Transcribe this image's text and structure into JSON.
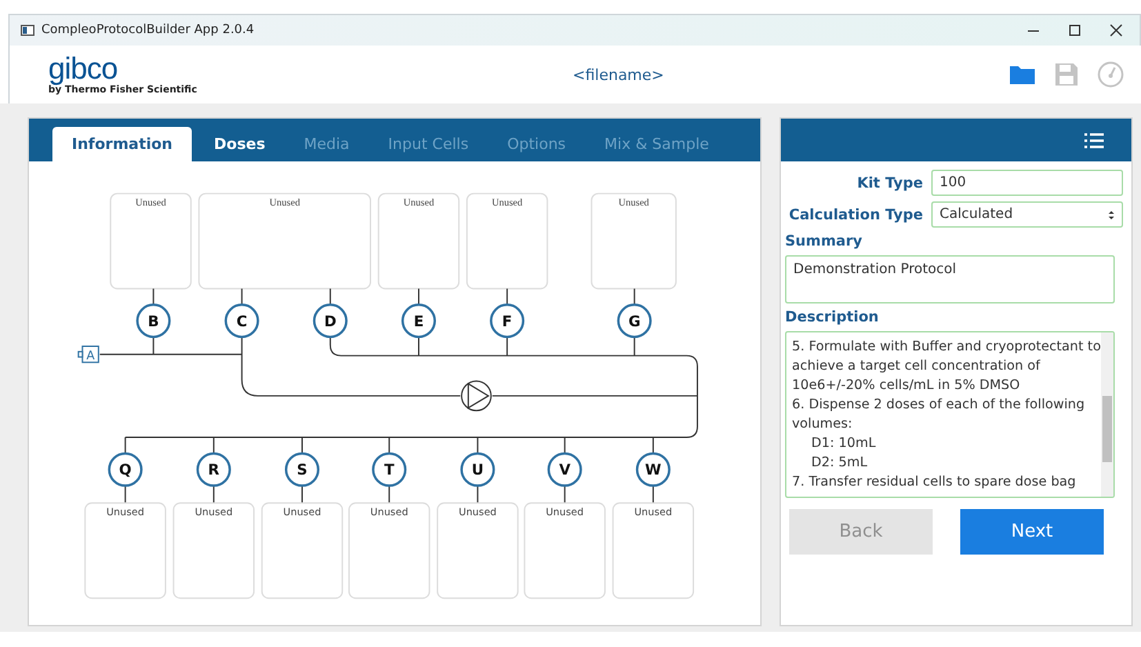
{
  "window": {
    "title": "CompleoProtocolBuilder App 2.0.4"
  },
  "header": {
    "logo": "gibco",
    "logo_sub": "by Thermo Fisher Scientific",
    "filename": "<filename>",
    "actions": [
      {
        "kind": "open",
        "disabled": false
      },
      {
        "kind": "save",
        "disabled": true
      },
      {
        "kind": "gauge",
        "disabled": true
      }
    ]
  },
  "tabs": [
    {
      "label": "Information",
      "selected": true,
      "disabled": false
    },
    {
      "label": "Doses",
      "selected": false,
      "disabled": false
    },
    {
      "label": "Media",
      "selected": false,
      "disabled": true
    },
    {
      "label": "Input Cells",
      "selected": false,
      "disabled": true
    },
    {
      "label": "Options",
      "selected": false,
      "disabled": true
    },
    {
      "label": "Mix & Sample",
      "selected": false,
      "disabled": true
    }
  ],
  "diagram": {
    "source": "A",
    "top_bags": [
      {
        "label": "Unused",
        "ports": [
          "B"
        ]
      },
      {
        "label": "Unused",
        "ports": [
          "C",
          "D"
        ]
      },
      {
        "label": "Unused",
        "ports": [
          "E"
        ]
      },
      {
        "label": "Unused",
        "ports": [
          "F"
        ]
      },
      {
        "label": "Unused",
        "ports": [
          "G"
        ]
      }
    ],
    "bottom_ports": [
      {
        "port": "Q",
        "bag": "Unused"
      },
      {
        "port": "R",
        "bag": "Unused"
      },
      {
        "port": "S",
        "bag": "Unused"
      },
      {
        "port": "T",
        "bag": "Unused"
      },
      {
        "port": "U",
        "bag": "Unused"
      },
      {
        "port": "V",
        "bag": "Unused"
      },
      {
        "port": "W",
        "bag": "Unused"
      }
    ]
  },
  "form": {
    "kit_type": {
      "label": "Kit Type",
      "value": "100"
    },
    "calculation_type": {
      "label": "Calculation Type",
      "value": "Calculated"
    },
    "summary": {
      "label": "Summary",
      "value": "Demonstration Protocol"
    },
    "description": {
      "label": "Description",
      "lines": [
        {
          "text": "5. Formulate with Buffer and cryoprotectant to",
          "indented": false
        },
        {
          "text": "achieve a target cell concentration of",
          "indented": false
        },
        {
          "text": "10e6+/-20% cells/mL in 5% DMSO",
          "indented": false
        },
        {
          "text": "6. Dispense 2 doses of each of the following",
          "indented": false
        },
        {
          "text": "volumes:",
          "indented": false
        },
        {
          "text": "D1: 10mL",
          "indented": true
        },
        {
          "text": "D2: 5mL",
          "indented": true
        },
        {
          "text": "7. Transfer residual cells to spare dose bag",
          "indented": false
        }
      ]
    }
  },
  "buttons": [
    {
      "label": "Back",
      "disabled": true
    },
    {
      "label": "Next",
      "disabled": false
    }
  ]
}
